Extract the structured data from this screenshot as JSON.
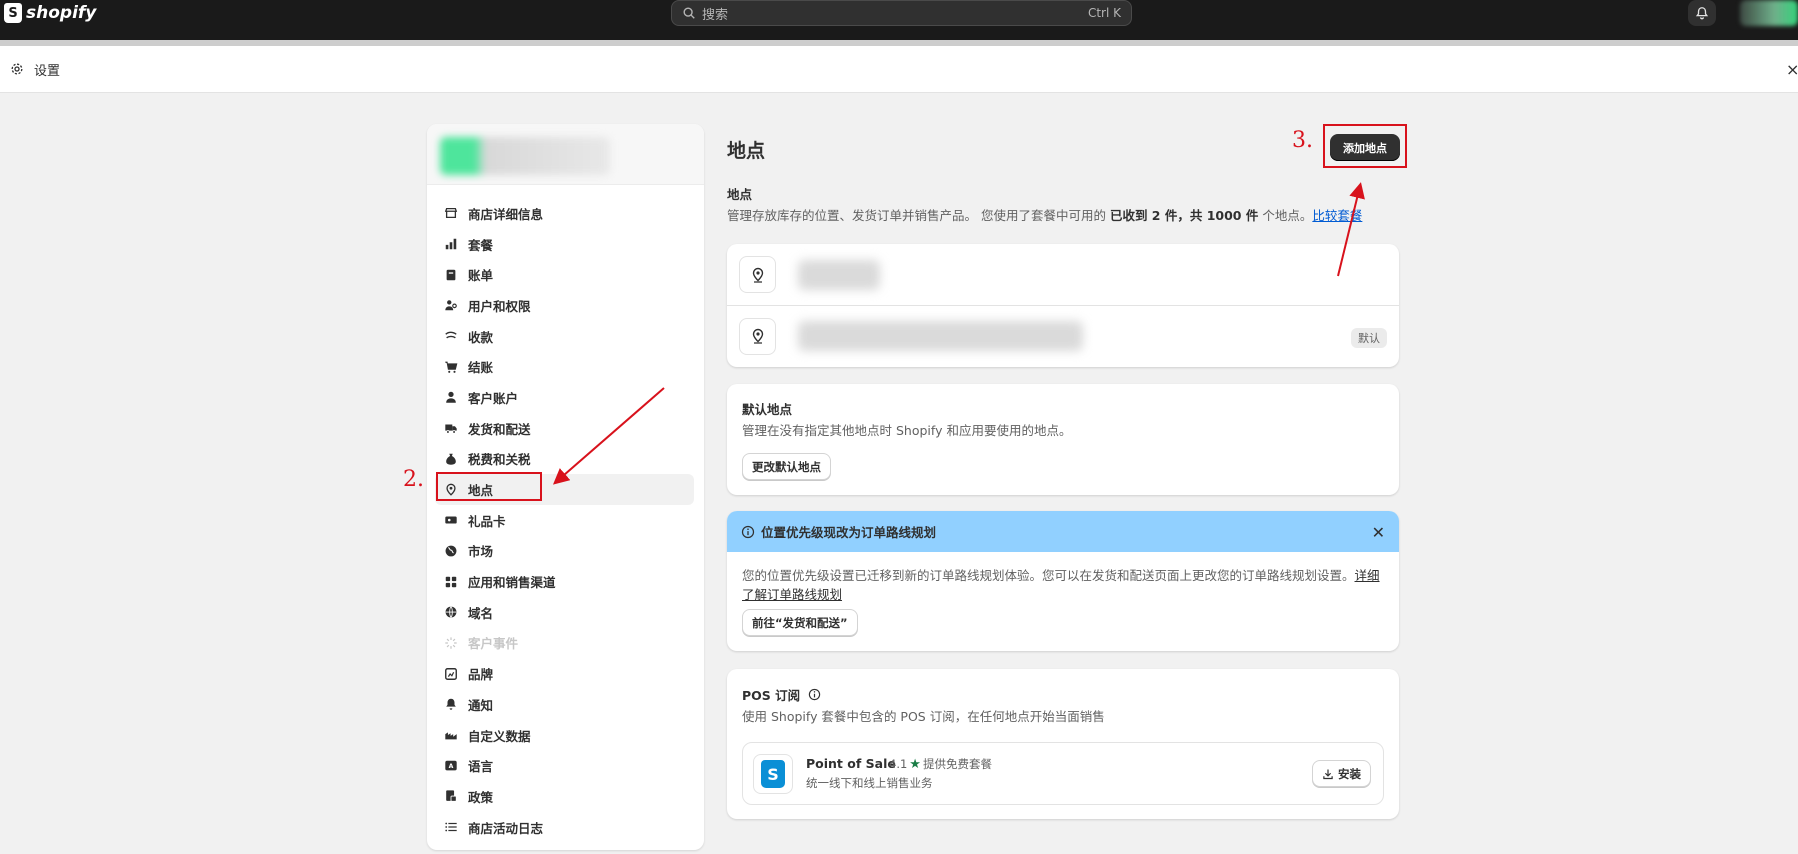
{
  "topbar": {
    "brand": "shopify",
    "brand_letter": "S",
    "search_placeholder": "搜索",
    "search_shortcut": "Ctrl K"
  },
  "settings": {
    "title": "设置",
    "close": "×"
  },
  "sidebar": {
    "items": [
      {
        "label": "商店详细信息",
        "icon": "store-icon"
      },
      {
        "label": "套餐",
        "icon": "plan-icon"
      },
      {
        "label": "账单",
        "icon": "billing-icon"
      },
      {
        "label": "用户和权限",
        "icon": "users-icon"
      },
      {
        "label": "收款",
        "icon": "payments-icon"
      },
      {
        "label": "结账",
        "icon": "cart-icon"
      },
      {
        "label": "客户账户",
        "icon": "person-icon"
      },
      {
        "label": "发货和配送",
        "icon": "truck-icon"
      },
      {
        "label": "税费和关税",
        "icon": "tax-icon"
      },
      {
        "label": "地点",
        "icon": "location-pin-icon",
        "active": true
      },
      {
        "label": "礼品卡",
        "icon": "gift-card-icon"
      },
      {
        "label": "市场",
        "icon": "globe-icon"
      },
      {
        "label": "应用和销售渠道",
        "icon": "apps-icon"
      },
      {
        "label": "域名",
        "icon": "domain-icon"
      },
      {
        "label": "客户事件",
        "icon": "events-icon",
        "disabled": true
      },
      {
        "label": "品牌",
        "icon": "brand-icon"
      },
      {
        "label": "通知",
        "icon": "bell-icon"
      },
      {
        "label": "自定义数据",
        "icon": "custom-data-icon"
      },
      {
        "label": "语言",
        "icon": "language-icon"
      },
      {
        "label": "政策",
        "icon": "policy-icon"
      },
      {
        "label": "商店活动日志",
        "icon": "list-icon"
      }
    ]
  },
  "main": {
    "title": "地点",
    "add_button": "添加地点",
    "section_label": "地点",
    "desc_prefix": "管理存放库存的位置、发货订单并销售产品。 您使用了套餐中可用的 ",
    "desc_bold": "已收到 2 件，共 1000 件",
    "desc_suffix": " 个地点。",
    "desc_link": "比较套餐",
    "default_badge": "默认",
    "default_location": {
      "title": "默认地点",
      "text": "管理在没有指定其他地点时 Shopify 和应用要使用的地点。",
      "button": "更改默认地点"
    },
    "banner": {
      "title": "位置优先级现改为订单路线规划",
      "body": "您的位置优先级设置已迁移到新的订单路线规划体验。您可以在发货和配送页面上更改您的订单路线规划设置。",
      "link": "详细了解订单路线规划",
      "button": "前往“发货和配送”"
    },
    "pos": {
      "title": "POS 订阅",
      "text": "使用 Shopify 套餐中包含的 POS 订阅，在任何地点开始当面销售",
      "app_name": "Point of Sale",
      "rating": "4.1",
      "rating_note": "提供免费套餐",
      "app_sub": "统一线下和线上销售业务",
      "install": "安装"
    }
  },
  "annotations": {
    "step2": "2.",
    "step3": "3.",
    "color": "#d8121c"
  }
}
